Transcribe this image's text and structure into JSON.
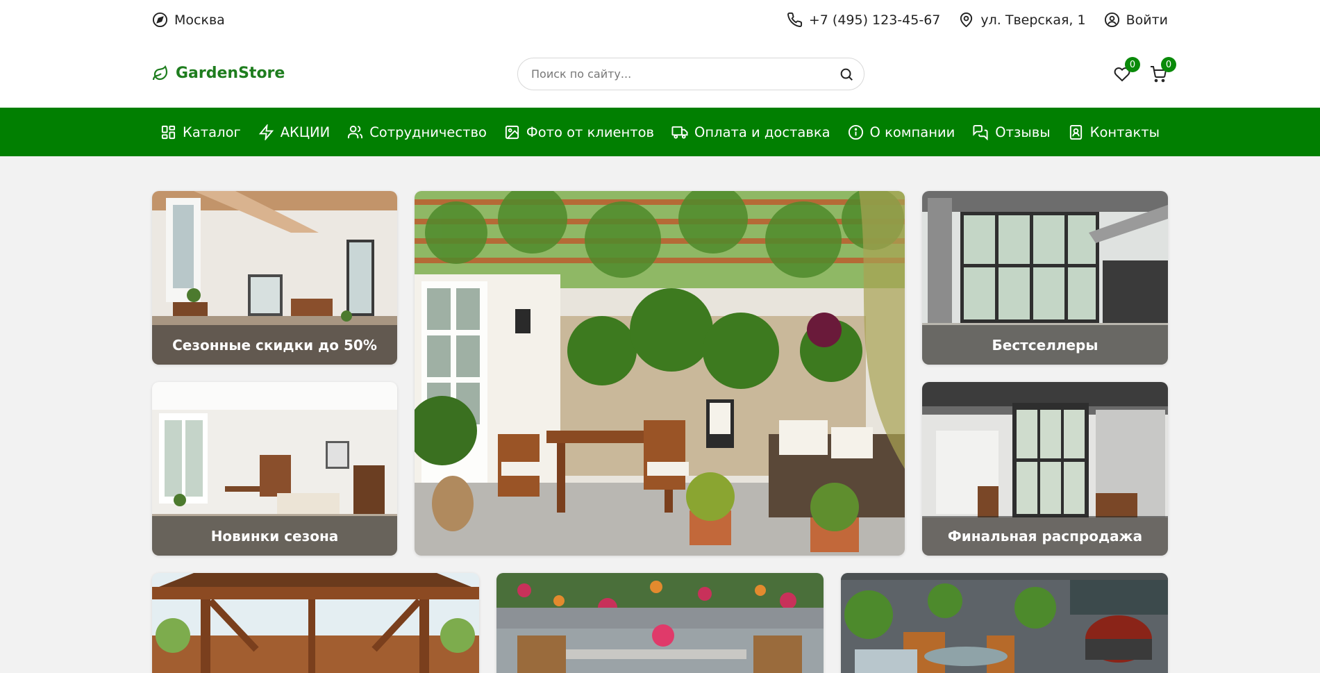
{
  "topbar": {
    "city": "Москва",
    "phone": "+7 (495) 123-45-67",
    "address": "ул. Тверская, 1",
    "login": "Войти",
    "icons": {
      "city": "compass-icon",
      "phone": "phone-icon",
      "address": "map-pin-icon",
      "login": "user-circle-icon"
    }
  },
  "header": {
    "logo_text": "GardenStore",
    "logo_icon": "leaf-icon",
    "search_placeholder": "Поиск по сайту...",
    "search_value": "",
    "favorites_count": "0",
    "cart_count": "0"
  },
  "nav": {
    "items": [
      {
        "label": "Каталог",
        "icon": "grid-icon"
      },
      {
        "label": "АКЦИИ",
        "icon": "lightning-icon"
      },
      {
        "label": "Сотрудничество",
        "icon": "users-icon"
      },
      {
        "label": "Фото от клиентов",
        "icon": "images-icon"
      },
      {
        "label": "Оплата и доставка",
        "icon": "truck-icon"
      },
      {
        "label": "О компании",
        "icon": "info-icon"
      },
      {
        "label": "Отзывы",
        "icon": "chat-icon"
      },
      {
        "label": "Контакты",
        "icon": "contact-book-icon"
      }
    ]
  },
  "promo": {
    "tiles": [
      {
        "caption": "Сезонные скидки до 50%"
      },
      {
        "caption": "Новинки сезона"
      },
      {
        "caption": "Бестселлеры"
      },
      {
        "caption": "Финальная распродажа"
      }
    ]
  },
  "colors": {
    "brand": "#017f01",
    "logo": "#1e7d1e",
    "badge": "#0a8a0a",
    "background": "#f2f2f2"
  }
}
